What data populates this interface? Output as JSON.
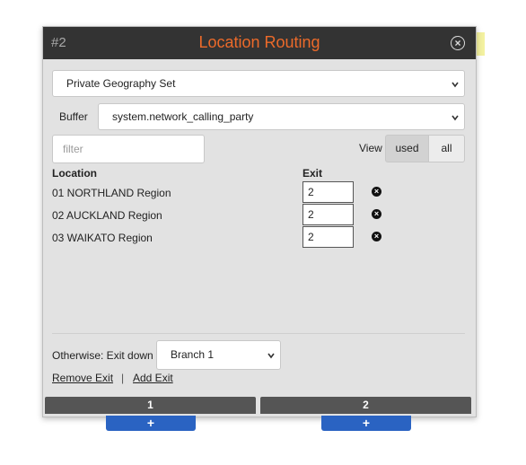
{
  "window": {
    "node_id": "#2",
    "title": "Location Routing",
    "close_icon": "close-circle-icon",
    "title_color": "#ec6a2a"
  },
  "geography_select": {
    "value": "Private Geography Set"
  },
  "buffer": {
    "label": "Buffer",
    "value": "system.network_calling_party"
  },
  "filter": {
    "placeholder": "filter"
  },
  "view": {
    "label": "View",
    "used_label": "used",
    "all_label": "all",
    "selected": "used"
  },
  "table": {
    "headers": {
      "location": "Location",
      "exit": "Exit"
    },
    "rows": [
      {
        "location": "01 NORTHLAND Region",
        "exit": "2"
      },
      {
        "location": "02 AUCKLAND Region",
        "exit": "2"
      },
      {
        "location": "03 WAIKATO Region",
        "exit": "2"
      }
    ]
  },
  "otherwise": {
    "label": "Otherwise: Exit down",
    "value": "Branch 1"
  },
  "actions": {
    "remove_exit": "Remove Exit",
    "separator": "|",
    "add_exit": "Add Exit"
  },
  "branches": [
    {
      "label": "1",
      "add_label": "+"
    },
    {
      "label": "2",
      "add_label": "+"
    }
  ]
}
